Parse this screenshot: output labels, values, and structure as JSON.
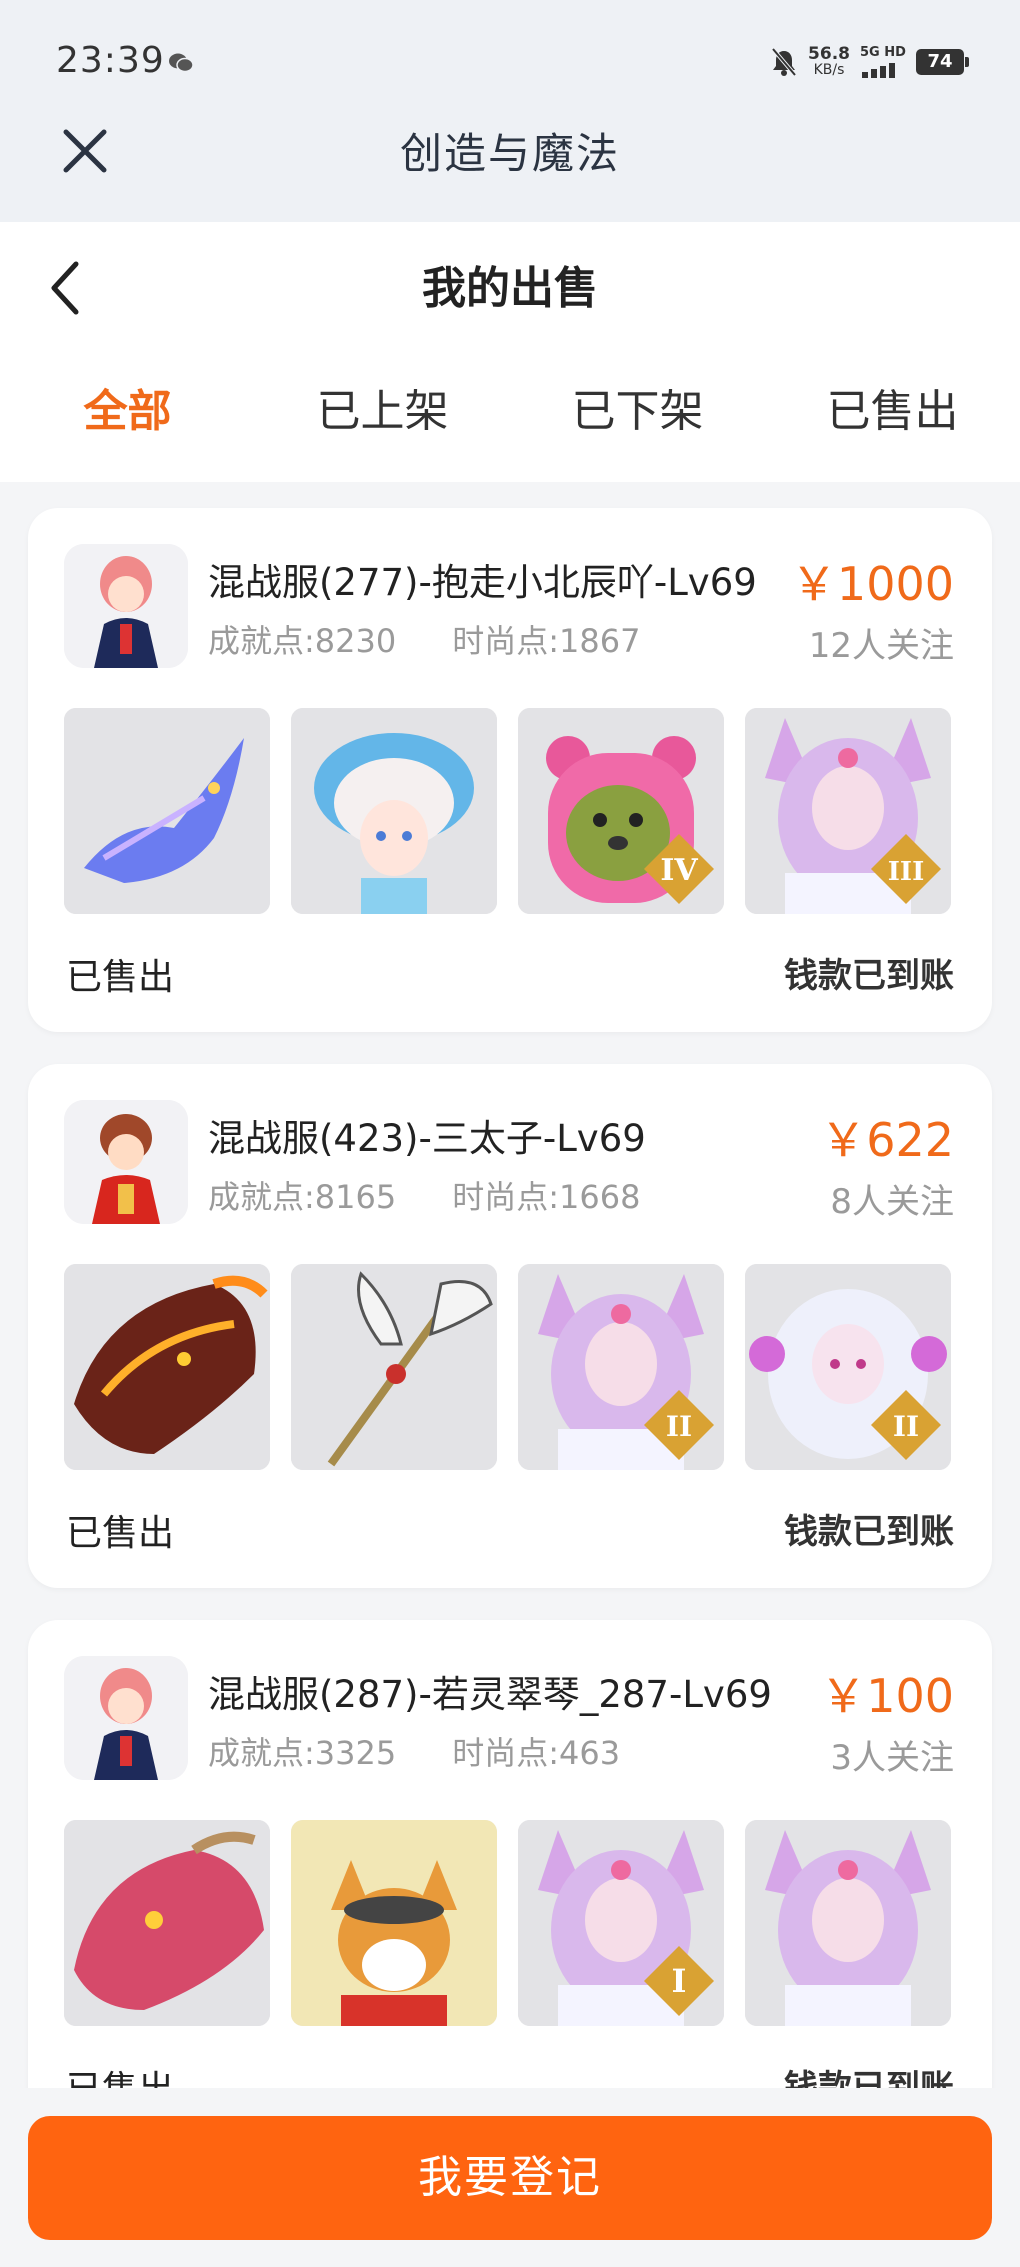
{
  "status_bar": {
    "time": "23:39",
    "net_speed_value": "56.8",
    "net_speed_unit": "KB/s",
    "network_label": "5G HD",
    "battery": "74"
  },
  "app": {
    "title": "创造与魔法"
  },
  "page": {
    "title": "我的出售"
  },
  "tabs": [
    {
      "label": "全部",
      "active": true
    },
    {
      "label": "已上架",
      "active": false
    },
    {
      "label": "已下架",
      "active": false
    },
    {
      "label": "已售出",
      "active": false
    }
  ],
  "listings": [
    {
      "name": "混战服(277)-抱走小北辰吖-Lv69",
      "achievement": "成就点:8230",
      "fashion": "时尚点:1867",
      "price": "￥1000",
      "followers": "12人关注",
      "status": "已售出",
      "payment": "钱款已到账",
      "badges": [
        "",
        "",
        "IV",
        "III"
      ]
    },
    {
      "name": "混战服(423)-三太子-Lv69",
      "achievement": "成就点:8165",
      "fashion": "时尚点:1668",
      "price": "￥622",
      "followers": "8人关注",
      "status": "已售出",
      "payment": "钱款已到账",
      "badges": [
        "",
        "",
        "II",
        "II"
      ]
    },
    {
      "name": "混战服(287)-若灵翠琴_287-Lv69",
      "achievement": "成就点:3325",
      "fashion": "时尚点:463",
      "price": "￥100",
      "followers": "3人关注",
      "status": "已售出",
      "payment": "钱款已到账",
      "badges": [
        "",
        "",
        "I",
        ""
      ]
    }
  ],
  "footer": {
    "register_label": "我要登记"
  },
  "colors": {
    "accent": "#f06a1a",
    "button": "#ff6410"
  }
}
